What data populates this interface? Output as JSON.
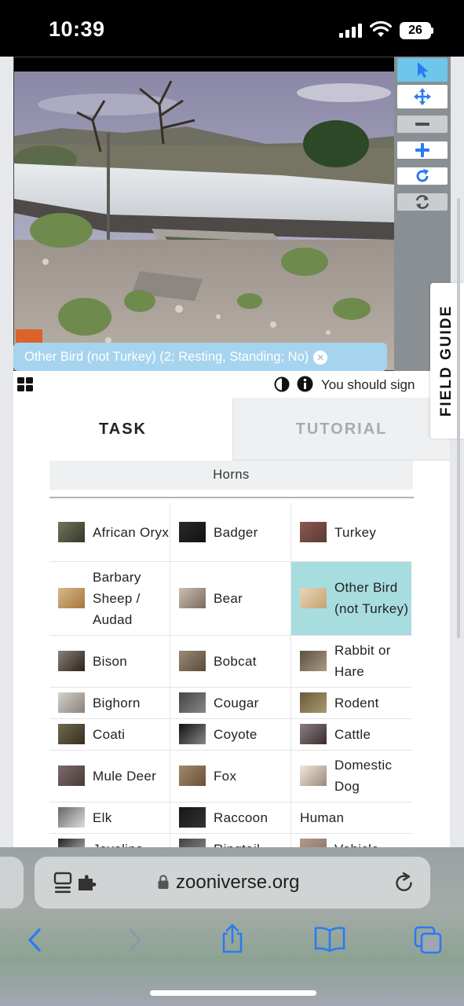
{
  "status_bar": {
    "time": "10:39",
    "battery": "26"
  },
  "subject": {
    "annotation_label": "Other Bird (not Turkey) (2; Resting, Standing; No)"
  },
  "toolbar": {
    "tools": [
      "pointer-icon",
      "move-icon",
      "zoom-out-icon",
      "zoom-in-icon",
      "rotate-icon",
      "reset-icon"
    ]
  },
  "below_image": {
    "signin_text": "You should sign"
  },
  "field_guide_label": "FIELD GUIDE",
  "tabs": {
    "task": "TASK",
    "tutorial": "TUTORIAL"
  },
  "filter": {
    "label": "Horns"
  },
  "species": [
    {
      "label": "African Oryx"
    },
    {
      "label": "Badger"
    },
    {
      "label": "Turkey"
    },
    {
      "label": "Barbary Sheep / Audad"
    },
    {
      "label": "Bear"
    },
    {
      "label": "Other Bird (not Turkey)",
      "selected": true
    },
    {
      "label": "Bison"
    },
    {
      "label": "Bobcat"
    },
    {
      "label": "Rabbit or Hare"
    },
    {
      "label": "Bighorn"
    },
    {
      "label": "Cougar"
    },
    {
      "label": "Rodent"
    },
    {
      "label": "Coati"
    },
    {
      "label": "Coyote"
    },
    {
      "label": "Cattle"
    },
    {
      "label": "Mule Deer"
    },
    {
      "label": "Fox"
    },
    {
      "label": "Domestic Dog"
    },
    {
      "label": "Elk"
    },
    {
      "label": "Raccoon"
    },
    {
      "label": "Human"
    },
    {
      "label": "Javelina"
    },
    {
      "label": "Ringtail"
    },
    {
      "label": "Vehicle"
    }
  ],
  "browser": {
    "url": "zooniverse.org"
  },
  "colors": {
    "accent": "#2a7bf4",
    "selected_cell": "#a8dde0",
    "annotation": "#a6d4ee"
  }
}
